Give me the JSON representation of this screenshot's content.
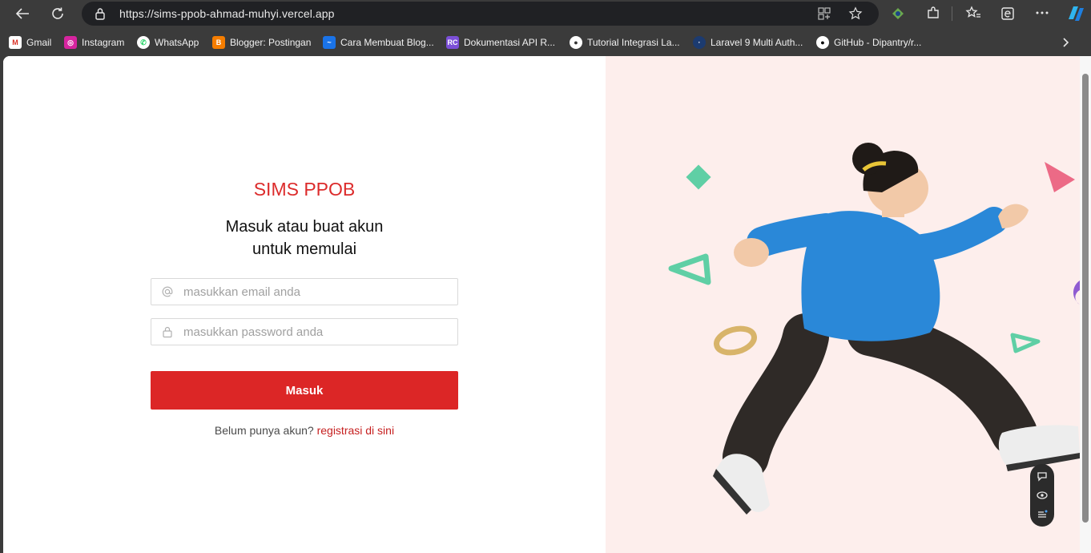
{
  "browser": {
    "url": "https://sims-ppob-ahmad-muhyi.vercel.app",
    "bookmarks": [
      {
        "label": "Gmail",
        "icon": "gmail-icon"
      },
      {
        "label": "Instagram",
        "icon": "instagram-icon"
      },
      {
        "label": "WhatsApp",
        "icon": "whatsapp-icon"
      },
      {
        "label": "Blogger: Postingan",
        "icon": "blogger-icon"
      },
      {
        "label": "Cara Membuat Blog...",
        "icon": "blog-icon"
      },
      {
        "label": "Dokumentasi API R...",
        "icon": "rc-icon"
      },
      {
        "label": "Tutorial Integrasi La...",
        "icon": "tutorial-icon"
      },
      {
        "label": "Laravel 9 Multi Auth...",
        "icon": "laravel-icon"
      },
      {
        "label": "GitHub - Dipantry/r...",
        "icon": "github-icon"
      }
    ]
  },
  "login": {
    "brand": "SIMS PPOB",
    "heading_line1": "Masuk atau buat akun",
    "heading_line2": "untuk memulai",
    "email_placeholder": "masukkan email anda",
    "password_placeholder": "masukkan password anda",
    "submit_label": "Masuk",
    "signup_prompt": "Belum punya akun?",
    "signup_link": "registrasi di sini"
  },
  "colors": {
    "accent": "#dc2626",
    "illustration_bg": "#fdeeec"
  }
}
